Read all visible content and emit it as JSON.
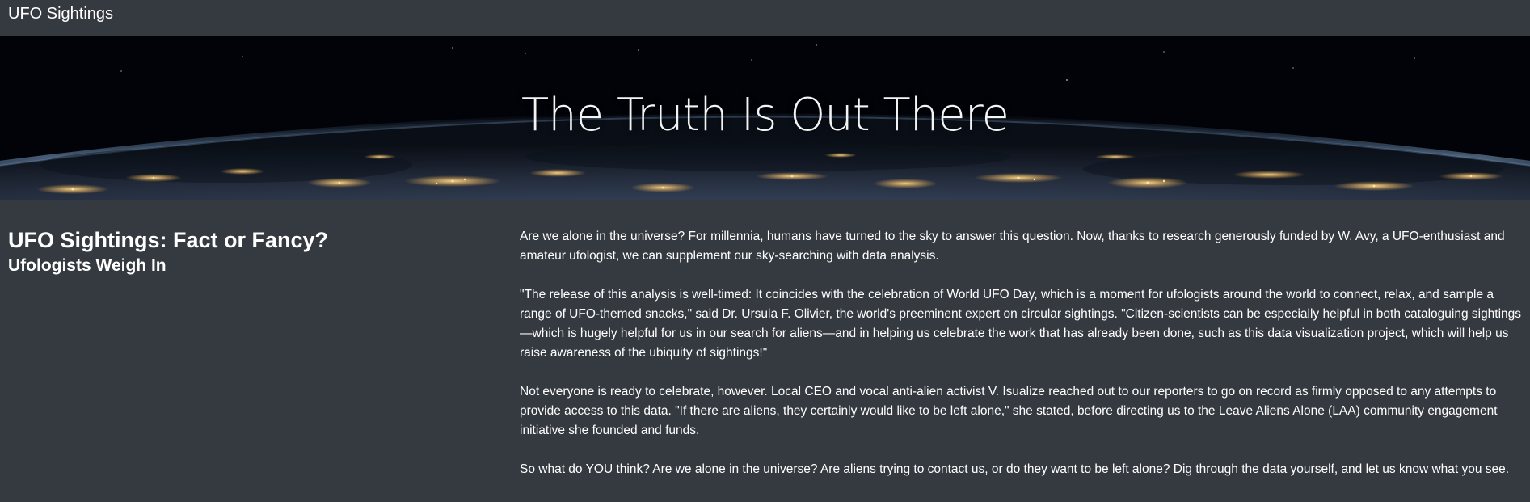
{
  "navbar": {
    "brand": "UFO Sightings"
  },
  "hero": {
    "title": "The Truth Is Out There",
    "background": "earth-at-night-from-orbit"
  },
  "article": {
    "headline": "UFO Sightings: Fact or Fancy?",
    "subheadline": "Ufologists Weigh In",
    "paragraphs": [
      "Are we alone in the universe? For millennia, humans have turned to the sky to answer this question. Now, thanks to research generously funded by W. Avy, a UFO-enthusiast and amateur ufologist, we can supplement our sky-searching with data analysis.",
      "\"The release of this analysis is well-timed: It coincides with the celebration of World UFO Day, which is a moment for ufologists around the world to connect, relax, and sample a range of UFO-themed snacks,\" said Dr. Ursula F. Olivier, the world's preeminent expert on circular sightings. \"Citizen-scientists can be especially helpful in both cataloguing sightings—which is hugely helpful for us in our search for aliens—and in helping us celebrate the work that has already been done, such as this data visualization project, which will help us raise awareness of the ubiquity of sightings!\"",
      "Not everyone is ready to celebrate, however. Local CEO and vocal anti-alien activist V. Isualize reached out to our reporters to go on record as firmly opposed to any attempts to provide access to this data. \"If there are aliens, they certainly would like to be left alone,\" she stated, before directing us to the Leave Aliens Alone (LAA) community engagement initiative she founded and funds.",
      "So what do YOU think? Are we alone in the universe? Are aliens trying to contact us, or do they want to be left alone? Dig through the data yourself, and let us know what you see."
    ]
  },
  "colors": {
    "page_background": "#353a40",
    "text": "#ffffff",
    "city_lights": "#f2c56b"
  }
}
